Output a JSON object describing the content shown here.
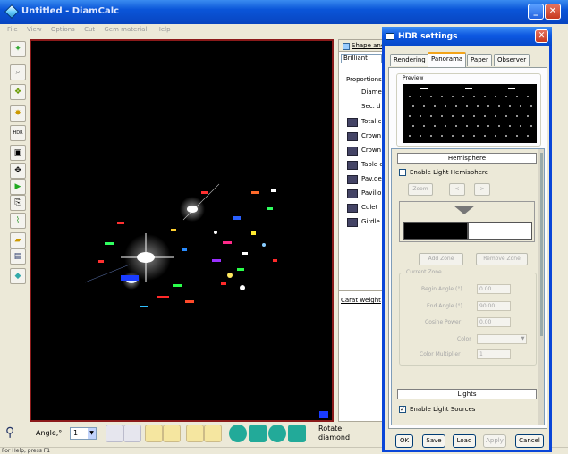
{
  "window": {
    "title": "Untitled - DiamCalc",
    "status": "For Help, press F1"
  },
  "menu": [
    "File",
    "View",
    "Options",
    "Cut",
    "Gem material",
    "Help"
  ],
  "shape_panel": {
    "header": "Shape and",
    "shape_value": "Brilliant",
    "proportions_label": "Proportions",
    "items_plain": [
      "Diamet",
      "Sec. d"
    ],
    "items_icon": [
      "Total c",
      "Crown",
      "Crown",
      "Table c",
      "Pav.de",
      "Pavilio",
      "Culet",
      "Girdle l"
    ],
    "carat_label": "Carat weight"
  },
  "bottom": {
    "angle_label": "Angle,°",
    "angle_value": "1",
    "rotate_label": "Rotate:",
    "rotate_value": "diamond"
  },
  "dialog": {
    "title": "HDR settings",
    "tabs": [
      "Rendering",
      "Panorama",
      "Paper",
      "Observer"
    ],
    "selected_tab": "Panorama",
    "preview_label": "Preview",
    "hemisphere": {
      "header": "Hemisphere",
      "enable_label": "Enable Light Hemisphere",
      "enable_checked": false,
      "zoom": "Zoom",
      "prev": "<",
      "next": ">",
      "add_zone": "Add Zone",
      "remove_zone": "Remove Zone",
      "current_zone_label": "Current Zone",
      "begin_angle_label": "Begin Angle (°)",
      "begin_angle_value": "0.00",
      "end_angle_label": "End Angle (°)",
      "end_angle_value": "90.00",
      "cosine_power_label": "Cosine Power",
      "cosine_power_value": "0.00",
      "color_label": "Color",
      "color_multiplier_label": "Color Multiplier",
      "color_multiplier_value": "1"
    },
    "lights": {
      "header": "Lights",
      "enable_label": "Enable Light Sources",
      "enable_checked": true
    },
    "buttons": {
      "ok": "OK",
      "save": "Save",
      "load": "Load",
      "apply": "Apply",
      "cancel": "Cancel"
    }
  },
  "colors": {
    "title_blue": "#0a55d8",
    "viewport_border": "#8b1a1a",
    "close_red": "#c7391f"
  }
}
